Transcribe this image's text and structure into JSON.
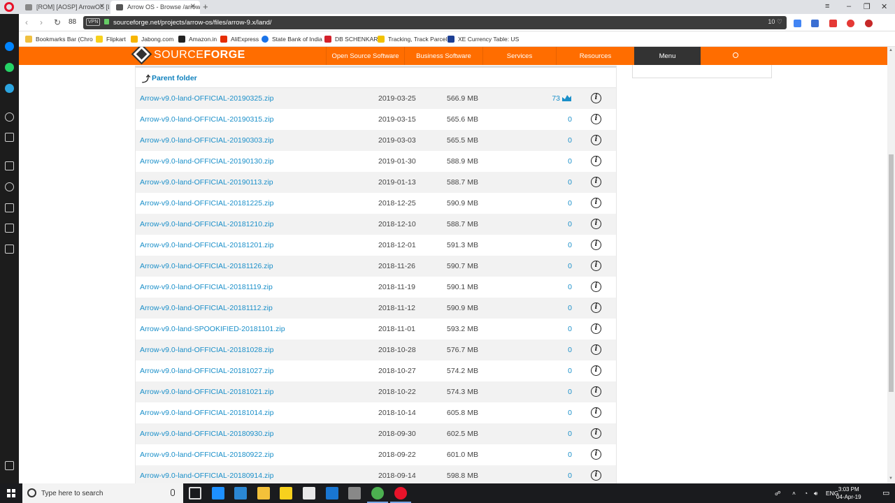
{
  "browser": {
    "tabs": [
      {
        "title": "[ROM] [AOSP] ArrowOS [L"
      },
      {
        "title": "Arrow OS - Browse /arrow"
      }
    ],
    "speed_dial_count": "88",
    "vpn_label": "VPN",
    "url": "sourceforge.net/projects/arrow-os/files/arrow-9.x/land/",
    "adblock_count": "10",
    "bookmarks": [
      {
        "label": "Bookmarks Bar (Chro",
        "color": "#f0c040"
      },
      {
        "label": "Flipkart",
        "color": "#f7d11d"
      },
      {
        "label": "Jabong.com",
        "color": "#f7b500"
      },
      {
        "label": "Amazon.in",
        "color": "#222222"
      },
      {
        "label": "AliExpress",
        "color": "#e62e04"
      },
      {
        "label": "State Bank of India",
        "color": "#1a73e8"
      },
      {
        "label": "DB SCHENKAR",
        "color": "#d3202b"
      },
      {
        "label": "Tracking, Track Parcel",
        "color": "#f2c200"
      },
      {
        "label": "XE Currency Table: US",
        "color": "#1c3f94"
      }
    ]
  },
  "site": {
    "logo_source": "SOURCE",
    "logo_forge": "FORGE",
    "nav": [
      {
        "label": "Open Source Software"
      },
      {
        "label": "Business Software"
      },
      {
        "label": "Services"
      },
      {
        "label": "Resources"
      },
      {
        "label": "Menu"
      }
    ],
    "parent_folder_label": "Parent folder",
    "info_glyph": "i",
    "files": [
      {
        "name": "Arrow-v9.0-land-OFFICIAL-20190325.zip",
        "date": "2019-03-25",
        "size": "566.9 MB",
        "downloads": "73"
      },
      {
        "name": "Arrow-v9.0-land-OFFICIAL-20190315.zip",
        "date": "2019-03-15",
        "size": "565.6 MB",
        "downloads": "0"
      },
      {
        "name": "Arrow-v9.0-land-OFFICIAL-20190303.zip",
        "date": "2019-03-03",
        "size": "565.5 MB",
        "downloads": "0"
      },
      {
        "name": "Arrow-v9.0-land-OFFICIAL-20190130.zip",
        "date": "2019-01-30",
        "size": "588.9 MB",
        "downloads": "0"
      },
      {
        "name": "Arrow-v9.0-land-OFFICIAL-20190113.zip",
        "date": "2019-01-13",
        "size": "588.7 MB",
        "downloads": "0"
      },
      {
        "name": "Arrow-v9.0-land-OFFICIAL-20181225.zip",
        "date": "2018-12-25",
        "size": "590.9 MB",
        "downloads": "0"
      },
      {
        "name": "Arrow-v9.0-land-OFFICIAL-20181210.zip",
        "date": "2018-12-10",
        "size": "588.7 MB",
        "downloads": "0"
      },
      {
        "name": "Arrow-v9.0-land-OFFICIAL-20181201.zip",
        "date": "2018-12-01",
        "size": "591.3 MB",
        "downloads": "0"
      },
      {
        "name": "Arrow-v9.0-land-OFFICIAL-20181126.zip",
        "date": "2018-11-26",
        "size": "590.7 MB",
        "downloads": "0"
      },
      {
        "name": "Arrow-v9.0-land-OFFICIAL-20181119.zip",
        "date": "2018-11-19",
        "size": "590.1 MB",
        "downloads": "0"
      },
      {
        "name": "Arrow-v9.0-land-OFFICIAL-20181112.zip",
        "date": "2018-11-12",
        "size": "590.9 MB",
        "downloads": "0"
      },
      {
        "name": "Arrow-v9.0-land-SPOOKIFIED-20181101.zip",
        "date": "2018-11-01",
        "size": "593.2 MB",
        "downloads": "0"
      },
      {
        "name": "Arrow-v9.0-land-OFFICIAL-20181028.zip",
        "date": "2018-10-28",
        "size": "576.7 MB",
        "downloads": "0"
      },
      {
        "name": "Arrow-v9.0-land-OFFICIAL-20181027.zip",
        "date": "2018-10-27",
        "size": "574.2 MB",
        "downloads": "0"
      },
      {
        "name": "Arrow-v9.0-land-OFFICIAL-20181021.zip",
        "date": "2018-10-22",
        "size": "574.3 MB",
        "downloads": "0"
      },
      {
        "name": "Arrow-v9.0-land-OFFICIAL-20181014.zip",
        "date": "2018-10-14",
        "size": "605.8 MB",
        "downloads": "0"
      },
      {
        "name": "Arrow-v9.0-land-OFFICIAL-20180930.zip",
        "date": "2018-09-30",
        "size": "602.5 MB",
        "downloads": "0"
      },
      {
        "name": "Arrow-v9.0-land-OFFICIAL-20180922.zip",
        "date": "2018-09-22",
        "size": "601.0 MB",
        "downloads": "0"
      },
      {
        "name": "Arrow-v9.0-land-OFFICIAL-20180914.zip",
        "date": "2018-09-14",
        "size": "598.8 MB",
        "downloads": "0"
      }
    ]
  },
  "taskbar": {
    "search_placeholder": "Type here to search",
    "language": "ENG",
    "time": "3:03 PM",
    "date": "04-Apr-19"
  },
  "colors": {
    "brand_orange": "#ff6d00",
    "link_blue": "#1a8fc9",
    "menu_dark": "#333333"
  }
}
